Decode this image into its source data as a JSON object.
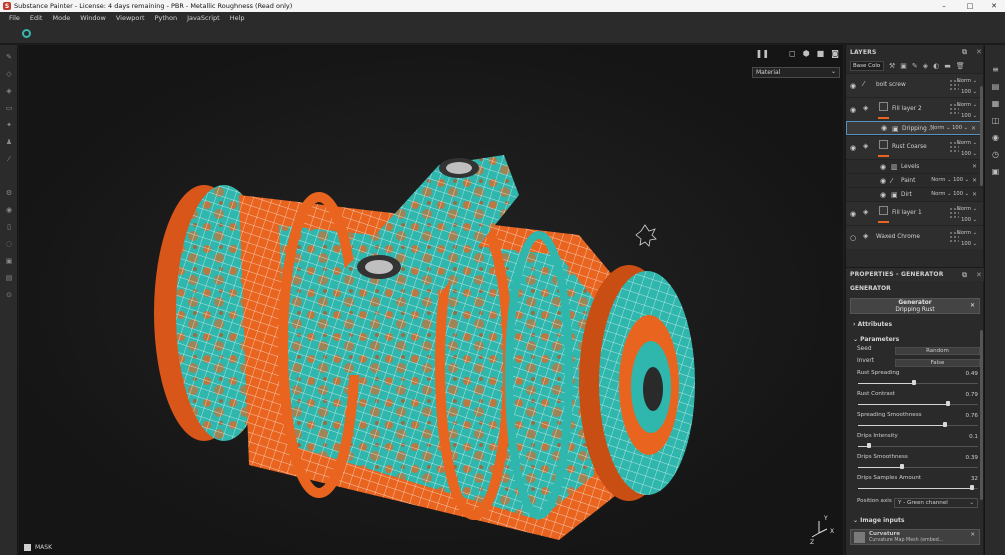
{
  "title_bar": {
    "text": "Substance Painter - License: 4 days remaining - PBR - Metallic Roughness (Read only)",
    "minimize": "–",
    "maximize": "□",
    "close": "✕"
  },
  "menu": [
    "File",
    "Edit",
    "Mode",
    "Window",
    "Viewport",
    "Python",
    "JavaScript",
    "Help"
  ],
  "viewport": {
    "material_mode": "Material",
    "mask_label": "MASK",
    "axis_y": "Y",
    "axis_x": "X",
    "axis_z": "Z"
  },
  "layers_panel": {
    "title": "LAYERS",
    "channel": "Base Colo",
    "layers": [
      {
        "name": "bolt screw",
        "blend": "Norm",
        "opacity": "100"
      },
      {
        "name": "Fill layer 2",
        "blend": "Norm",
        "opacity": "100"
      },
      {
        "name": "Dripping ...",
        "blend": "Norm",
        "opacity": "100"
      },
      {
        "name": "Rust Coarse",
        "blend": "Norm",
        "opacity": "100"
      },
      {
        "name": "Levels"
      },
      {
        "name": "Paint",
        "blend": "Norm",
        "opacity": "100"
      },
      {
        "name": "Dirt",
        "blend": "Norm",
        "opacity": "100"
      },
      {
        "name": "Fill layer 1",
        "blend": "Norm",
        "opacity": "100"
      },
      {
        "name": "Waxed Chrome",
        "blend": "Norm",
        "opacity": "100"
      }
    ]
  },
  "properties": {
    "title": "PROPERTIES - GENERATOR",
    "section": "GENERATOR",
    "generator_label": "Generator",
    "generator_value": "Dripping Rust",
    "attributes": "Attributes",
    "parameters": "Parameters",
    "seed_label": "Seed",
    "seed_value": "Random",
    "invert_label": "Invert",
    "invert_value": "False",
    "sliders": [
      {
        "label": "Rust Spreading",
        "value": "0.49",
        "fraction": 0.49
      },
      {
        "label": "Rust Contrast",
        "value": "0.79",
        "fraction": 0.79
      },
      {
        "label": "Spreading Smoothness",
        "value": "0.76",
        "fraction": 0.76
      },
      {
        "label": "Drips Intensity",
        "value": "0.1",
        "fraction": 0.1
      },
      {
        "label": "Drips Smoothness",
        "value": "0.39",
        "fraction": 0.39
      },
      {
        "label": "Drips Samples Amount",
        "value": "32",
        "fraction": 1.0
      }
    ],
    "position_axis_label": "Position axis",
    "position_axis_value": "Y - Green channel",
    "image_inputs": "Image inputs",
    "curvature_label": "Curvature",
    "curvature_sub": "Curvature Map   Mesh (embed..."
  },
  "colors": {
    "rust": "#e8641f",
    "teal": "#2fb6ad"
  }
}
